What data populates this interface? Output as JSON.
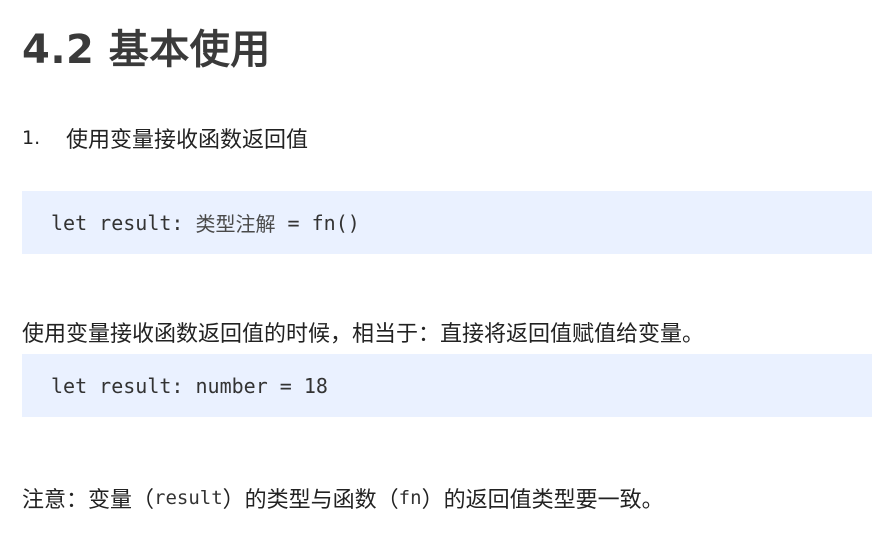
{
  "heading": {
    "title": "4.2 基本使用"
  },
  "list": {
    "number": "1.",
    "text": "使用变量接收函数返回值"
  },
  "code_blocks": [
    {
      "prefix": "let result: ",
      "type_annotation": "类型注解",
      "suffix": " = fn()"
    },
    {
      "line": "let result: number = 18"
    }
  ],
  "paragraphs": {
    "explanation": "使用变量接收函数返回值的时候，相当于：直接将返回值赋值给变量。",
    "note": {
      "prefix": "注意：变量（",
      "result_code": "result",
      "middle": "）的类型与函数（",
      "fn_code": "fn",
      "suffix": "）的返回值类型要一致。"
    }
  },
  "colors": {
    "code_background": "#eaf1ff",
    "heading_text": "#3a3a3a",
    "body_text": "#222222"
  }
}
